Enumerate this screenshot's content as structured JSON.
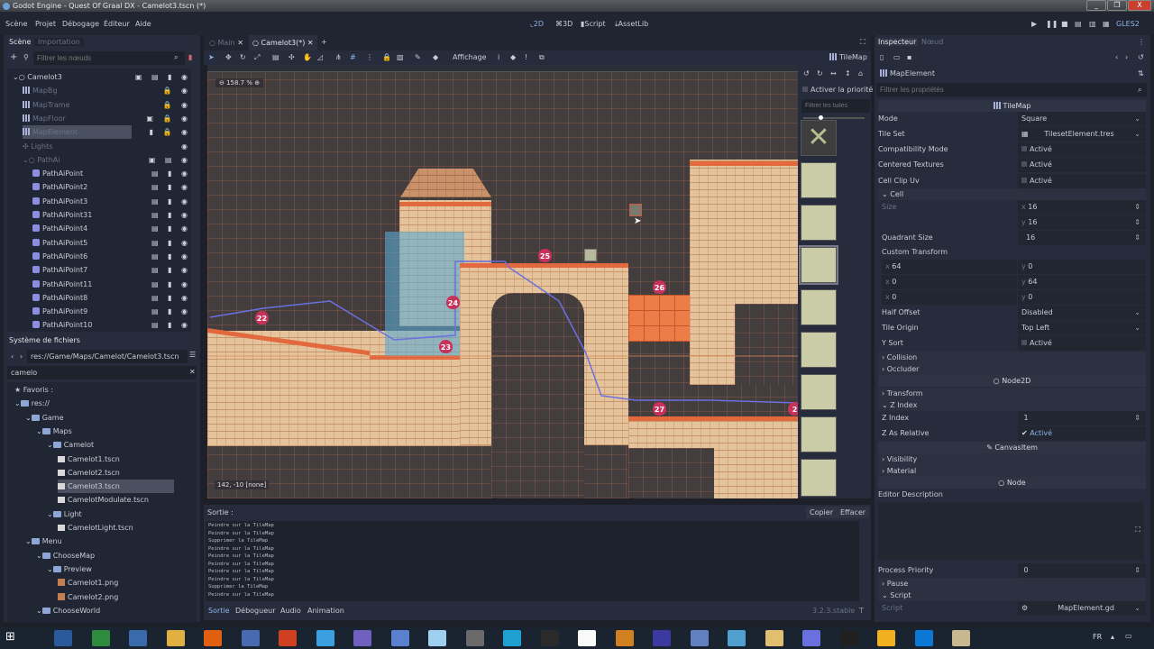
{
  "window": {
    "title": "Godot Engine - Quest Of Graal DX - Camelot3.tscn (*)",
    "min": "_",
    "max": "❐",
    "close": "X"
  },
  "menu": [
    "Scène",
    "Projet",
    "Débogage",
    "Éditeur",
    "Aide"
  ],
  "main_screens": [
    "2D",
    "3D",
    "Script",
    "AssetLib"
  ],
  "renderer": "GLES2",
  "scene_dock": {
    "tabs": [
      "Scène",
      "Importation"
    ],
    "filter_placeholder": "Filtrer les nœuds",
    "nodes": [
      {
        "name": "Camelot3",
        "depth": 0,
        "dim": false,
        "icons": "▣ ▤ ▮ ◉"
      },
      {
        "name": "MapBg",
        "depth": 1,
        "dim": true,
        "icons": "🔒 ◉"
      },
      {
        "name": "MapTrame",
        "depth": 1,
        "dim": true,
        "icons": "🔒 ◉"
      },
      {
        "name": "MapFloor",
        "depth": 1,
        "dim": true,
        "icons": "▣ 🔒 ◉"
      },
      {
        "name": "MapElement",
        "depth": 1,
        "dim": true,
        "icons": "▮ 🔒 ◉",
        "selected": true
      },
      {
        "name": "Lights",
        "depth": 1,
        "dim": true,
        "icons": "◉"
      },
      {
        "name": "PathAi",
        "depth": 1,
        "dim": true,
        "icons": "▣ ▤ ◉"
      },
      {
        "name": "PathAiPoint",
        "depth": 2,
        "dim": false,
        "icons": "▤ ▮ ◉"
      },
      {
        "name": "PathAiPoint2",
        "depth": 2,
        "dim": false,
        "icons": "▤ ▮ ◉"
      },
      {
        "name": "PathAiPoint3",
        "depth": 2,
        "dim": false,
        "icons": "▤ ▮ ◉"
      },
      {
        "name": "PathAiPoint31",
        "depth": 2,
        "dim": false,
        "icons": "▤ ▮ ◉"
      },
      {
        "name": "PathAiPoint4",
        "depth": 2,
        "dim": false,
        "icons": "▤ ▮ ◉"
      },
      {
        "name": "PathAiPoint5",
        "depth": 2,
        "dim": false,
        "icons": "▤ ▮ ◉"
      },
      {
        "name": "PathAiPoint6",
        "depth": 2,
        "dim": false,
        "icons": "▤ ▮ ◉"
      },
      {
        "name": "PathAiPoint7",
        "depth": 2,
        "dim": false,
        "icons": "▤ ▮ ◉"
      },
      {
        "name": "PathAiPoint11",
        "depth": 2,
        "dim": false,
        "icons": "▤ ▮ ◉"
      },
      {
        "name": "PathAiPoint8",
        "depth": 2,
        "dim": false,
        "icons": "▤ ▮ ◉"
      },
      {
        "name": "PathAiPoint9",
        "depth": 2,
        "dim": false,
        "icons": "▤ ▮ ◉"
      },
      {
        "name": "PathAiPoint10",
        "depth": 2,
        "dim": false,
        "icons": "▤ ▮ ◉"
      }
    ]
  },
  "filesystem": {
    "title": "Système de fichiers",
    "path": "res://Game/Maps/Camelot/Camelot3.tscn",
    "search": "camelo",
    "items": [
      {
        "name": "Favoris :",
        "depth": 0,
        "type": "fav"
      },
      {
        "name": "res://",
        "depth": 0,
        "type": "folder"
      },
      {
        "name": "Game",
        "depth": 1,
        "type": "folder"
      },
      {
        "name": "Maps",
        "depth": 2,
        "type": "folder"
      },
      {
        "name": "Camelot",
        "depth": 3,
        "type": "folder"
      },
      {
        "name": "Camelot1.tscn",
        "depth": 4,
        "type": "scene"
      },
      {
        "name": "Camelot2.tscn",
        "depth": 4,
        "type": "scene"
      },
      {
        "name": "Camelot3.tscn",
        "depth": 4,
        "type": "scene",
        "selected": true
      },
      {
        "name": "CamelotModulate.tscn",
        "depth": 4,
        "type": "scene"
      },
      {
        "name": "Light",
        "depth": 3,
        "type": "folder"
      },
      {
        "name": "CamelotLight.tscn",
        "depth": 4,
        "type": "scene"
      },
      {
        "name": "Menu",
        "depth": 1,
        "type": "folder"
      },
      {
        "name": "ChooseMap",
        "depth": 2,
        "type": "folder"
      },
      {
        "name": "Preview",
        "depth": 3,
        "type": "folder"
      },
      {
        "name": "Camelot1.png",
        "depth": 4,
        "type": "png"
      },
      {
        "name": "Camelot2.png",
        "depth": 4,
        "type": "png"
      },
      {
        "name": "ChooseWorld",
        "depth": 2,
        "type": "folder"
      }
    ]
  },
  "editor_tabs": [
    "Main",
    "Camelot3(*)"
  ],
  "toolbar": {
    "view_menu": "Affichage",
    "tilemap_label": "TileMap"
  },
  "viewport": {
    "zoom": "158.7 %",
    "coords": "142, -10 [none]",
    "markers": [
      "22",
      "23",
      "24",
      "25",
      "26",
      "27",
      "2"
    ]
  },
  "tile_palette": {
    "priority_label": "Activer la priorité",
    "filter_placeholder": "Filtrer les tuiles"
  },
  "bottom": {
    "output_label": "Sortie :",
    "copy": "Copier",
    "clear": "Effacer",
    "version": "3.2.3.stable",
    "lines": [
      "Peindre sur la TileMap",
      "Peindre sur la TileMap",
      "Supprimer la TileMap",
      "Peindre sur la TileMap",
      "Peindre sur la TileMap",
      "Peindre sur la TileMap",
      "Peindre sur la TileMap",
      "Peindre sur la TileMap",
      "Supprimer la TileMap",
      "Peindre sur la TileMap"
    ],
    "tabs": [
      "Sortie",
      "Débogueur",
      "Audio",
      "Animation"
    ]
  },
  "inspector": {
    "tabs": [
      "Inspecteur",
      "Nœud"
    ],
    "node": "MapElement",
    "filter_placeholder": "Filtrer les propriétés",
    "class_tilemap": "TileMap",
    "mode_l": "Mode",
    "mode": "Square",
    "tileset_l": "Tile Set",
    "tileset": "TilesetElement.tres",
    "compat_l": "Compatibility Mode",
    "centered_l": "Centered Textures",
    "clipuv_l": "Cell Clip Uv",
    "on": "Activé",
    "cell": "Cell",
    "size_l": "Size",
    "size_x": "16",
    "size_y": "16",
    "quad_l": "Quadrant Size",
    "quad": "16",
    "ct_l": "Custom Transform",
    "ct": [
      [
        "64",
        "0"
      ],
      [
        "0",
        "64"
      ],
      [
        "0",
        "0"
      ]
    ],
    "half_l": "Half Offset",
    "half": "Disabled",
    "origin_l": "Tile Origin",
    "origin": "Top Left",
    "ysort_l": "Y Sort",
    "collision": "Collision",
    "occluder": "Occluder",
    "class_node2d": "Node2D",
    "transform": "Transform",
    "zindex_sec": "Z Index",
    "zindex_l": "Z Index",
    "zindex": "1",
    "zrel_l": "Z As Relative",
    "class_canvas": "CanvasItem",
    "visibility": "Visibility",
    "material": "Material",
    "class_node": "Node",
    "desc_l": "Editor Description",
    "prio_l": "Process Priority",
    "prio": "0",
    "pause": "Pause",
    "script_sec": "Script",
    "script_l": "Script",
    "script": "MapElement.gd"
  },
  "taskbar": {
    "lang": "FR"
  }
}
